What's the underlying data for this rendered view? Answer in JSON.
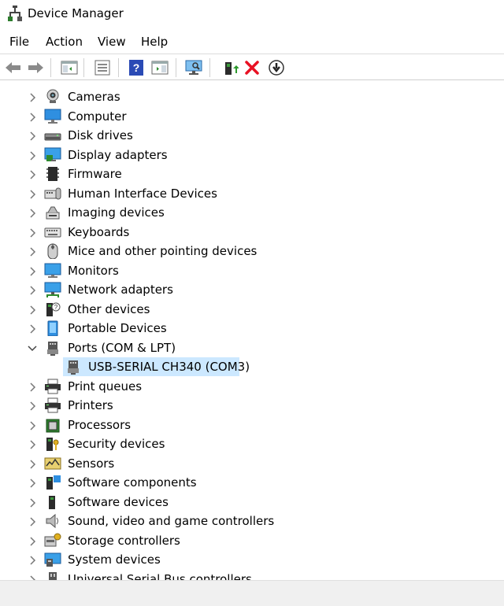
{
  "window": {
    "title": "Device Manager",
    "app_icon": "device-manager-icon"
  },
  "menu": [
    "File",
    "Action",
    "View",
    "Help"
  ],
  "toolbar": {
    "buttons": [
      "back-icon",
      "forward-icon",
      "show-hide-console-tree-icon",
      "properties-icon",
      "help-icon",
      "show-action-pane-icon",
      "scan-hardware-changes-icon",
      "update-driver-icon",
      "uninstall-icon",
      "disable-device-icon"
    ],
    "colors": {
      "accent_blue": "#1e66c8",
      "uninstall_red": "#e81123"
    }
  },
  "tree": {
    "selected_color": "#cce8ff",
    "items": [
      {
        "label": "Cameras",
        "icon": "camera-icon"
      },
      {
        "label": "Computer",
        "icon": "computer-icon"
      },
      {
        "label": "Disk drives",
        "icon": "disk-drive-icon"
      },
      {
        "label": "Display adapters",
        "icon": "display-adapter-icon"
      },
      {
        "label": "Firmware",
        "icon": "firmware-icon"
      },
      {
        "label": "Human Interface Devices",
        "icon": "hid-icon"
      },
      {
        "label": "Imaging devices",
        "icon": "imaging-device-icon"
      },
      {
        "label": "Keyboards",
        "icon": "keyboard-icon"
      },
      {
        "label": "Mice and other pointing devices",
        "icon": "mouse-icon"
      },
      {
        "label": "Monitors",
        "icon": "monitor-icon"
      },
      {
        "label": "Network adapters",
        "icon": "network-adapter-icon"
      },
      {
        "label": "Other devices",
        "icon": "other-devices-icon"
      },
      {
        "label": "Portable Devices",
        "icon": "portable-device-icon"
      },
      {
        "label": "Ports (COM & LPT)",
        "icon": "port-icon",
        "expanded": true
      },
      {
        "label": "USB-SERIAL CH340 (COM3)",
        "icon": "port-icon",
        "child": true,
        "selected": true
      },
      {
        "label": "Print queues",
        "icon": "printer-icon"
      },
      {
        "label": "Printers",
        "icon": "printer-icon"
      },
      {
        "label": "Processors",
        "icon": "processor-icon"
      },
      {
        "label": "Security devices",
        "icon": "security-device-icon"
      },
      {
        "label": "Sensors",
        "icon": "sensor-icon"
      },
      {
        "label": "Software components",
        "icon": "software-component-icon"
      },
      {
        "label": "Software devices",
        "icon": "software-device-icon"
      },
      {
        "label": "Sound, video and game controllers",
        "icon": "speaker-icon"
      },
      {
        "label": "Storage controllers",
        "icon": "storage-controller-icon"
      },
      {
        "label": "System devices",
        "icon": "system-device-icon"
      },
      {
        "label": "Universal Serial Bus controllers",
        "icon": "usb-icon"
      }
    ]
  }
}
